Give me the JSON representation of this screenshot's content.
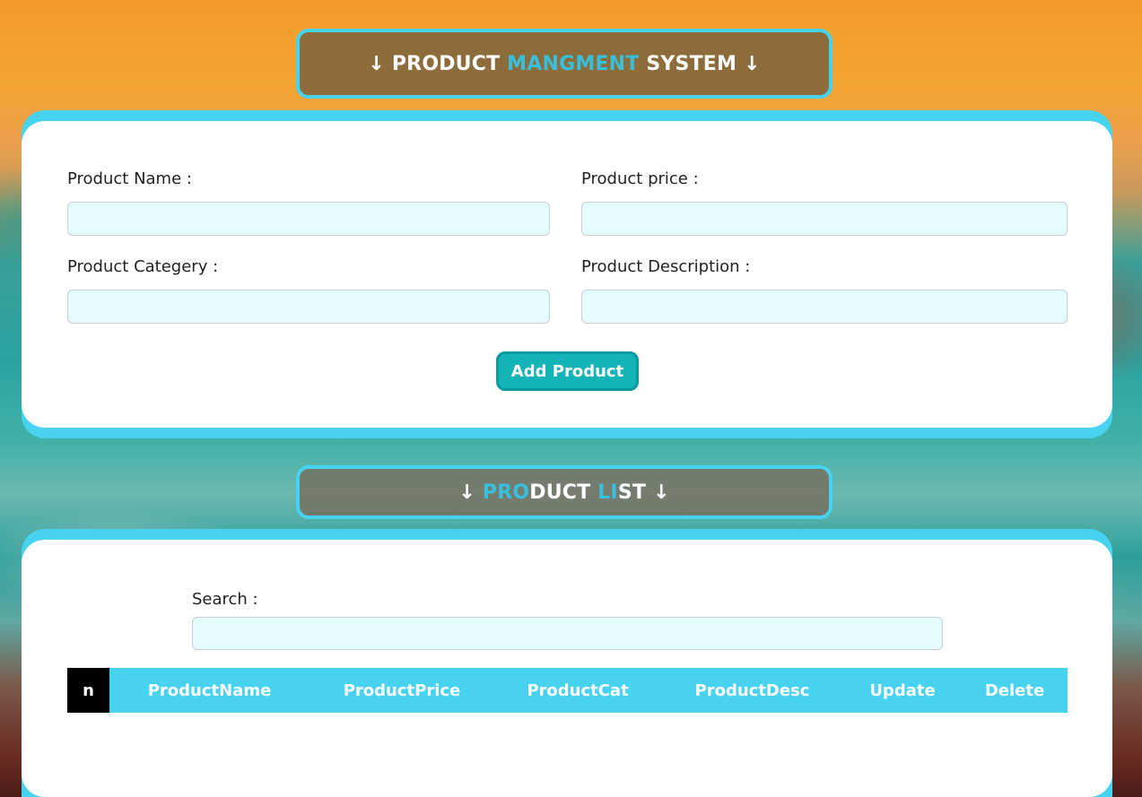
{
  "header": {
    "arrow_left": "↓",
    "title_part1": " PRODUCT ",
    "title_highlight": "MANGMENT",
    "title_part2": " SYSTEM ",
    "arrow_right": "↓"
  },
  "form": {
    "product_name_label": "Product Name :",
    "product_name_value": "",
    "product_price_label": "Product price :",
    "product_price_value": "",
    "product_category_label": "Product Categery :",
    "product_category_value": "",
    "product_description_label": "Product Description :",
    "product_description_value": "",
    "add_button_label": "Add Product"
  },
  "list_header": {
    "arrow_left": "↓ ",
    "pro": "PRO",
    "duct": "DUCT ",
    "li": "LI",
    "st": "ST",
    "arrow_right": " ↓"
  },
  "search": {
    "label": "Search :",
    "value": ""
  },
  "table": {
    "columns": [
      "n",
      "ProductName",
      "ProductPrice",
      "ProductCat",
      "ProductDesc",
      "Update",
      "Delete"
    ]
  },
  "colors": {
    "accent": "#47d3ef",
    "button": "#13b3b8",
    "input_bg": "#e6fdfd"
  }
}
